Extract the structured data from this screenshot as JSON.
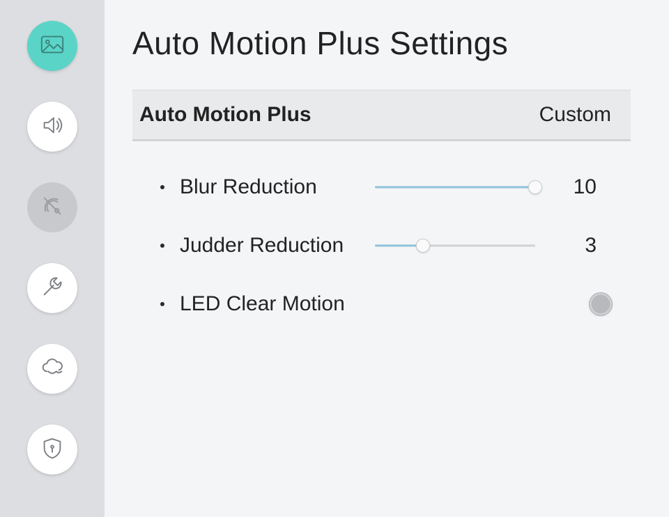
{
  "title": "Auto Motion Plus Settings",
  "header": {
    "label": "Auto Motion Plus",
    "value": "Custom"
  },
  "rows": {
    "blur": {
      "label": "Blur Reduction",
      "value": 10,
      "max": 10
    },
    "judder": {
      "label": "Judder Reduction",
      "value": 3,
      "max": 10
    },
    "led": {
      "label": "LED Clear Motion",
      "on": false
    }
  },
  "sidebar": {
    "items": [
      {
        "name": "picture",
        "active": true
      },
      {
        "name": "sound"
      },
      {
        "name": "broadcast",
        "disabled": true
      },
      {
        "name": "support"
      },
      {
        "name": "cloud"
      },
      {
        "name": "security"
      }
    ]
  }
}
